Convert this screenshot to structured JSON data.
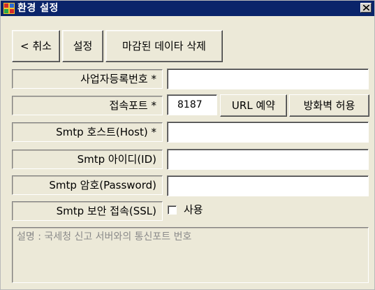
{
  "window": {
    "title": "환경 설정",
    "close_label": "close"
  },
  "toolbar": {
    "cancel_label": "< 취소",
    "save_label": "설정",
    "delete_closed_label": "마감된 데이타 삭제"
  },
  "fields": [
    {
      "label": "사업자등록번호 *",
      "value": ""
    },
    {
      "label": "접속포트 *",
      "value": "8187"
    },
    {
      "label": "Smtp 호스트(Host) *",
      "value": ""
    },
    {
      "label": "Smtp 아이디(ID)",
      "value": ""
    },
    {
      "label": "Smtp 암호(Password)",
      "value": ""
    },
    {
      "label": "Smtp 보안 접속(SSL)"
    }
  ],
  "port_buttons": {
    "url_reserve": "URL 예약",
    "firewall_allow": "방화벽 허용"
  },
  "ssl": {
    "checkbox_label": "사용",
    "checked": false
  },
  "description": "설명 : 국세청 신고 서버와의 통신포트 번호",
  "colors": {
    "titlebar": "#0a246a",
    "face": "#ece9d8",
    "description_text": "#8a8a8a"
  },
  "icons": {
    "app": "settings-app-icon",
    "close": "close-icon"
  }
}
